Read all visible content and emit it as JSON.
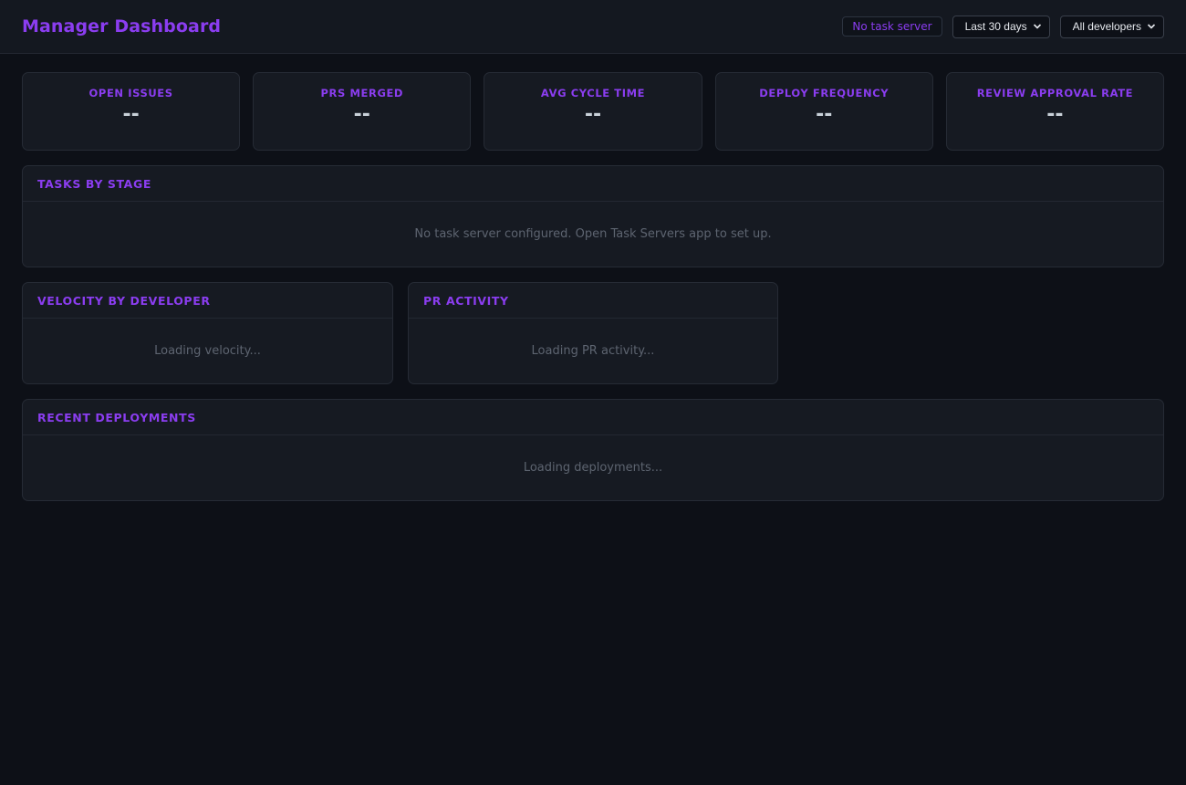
{
  "header": {
    "title": "Manager Dashboard",
    "status_badge": "No task server",
    "range_select": "Last 30 days",
    "developer_select": "All developers"
  },
  "stats": [
    {
      "label": "OPEN ISSUES",
      "value": "--"
    },
    {
      "label": "PRS MERGED",
      "value": "--"
    },
    {
      "label": "AVG CYCLE TIME",
      "value": "--"
    },
    {
      "label": "DEPLOY FREQUENCY",
      "value": "--"
    },
    {
      "label": "REVIEW APPROVAL RATE",
      "value": "--"
    }
  ],
  "panels": {
    "tasks_by_stage": {
      "title": "TASKS BY STAGE",
      "message": "No task server configured. Open Task Servers app to set up."
    },
    "velocity": {
      "title": "VELOCITY BY DEVELOPER",
      "message": "Loading velocity..."
    },
    "pr_activity": {
      "title": "PR ACTIVITY",
      "message": "Loading PR activity..."
    },
    "deployments": {
      "title": "RECENT DEPLOYMENTS",
      "message": "Loading deployments..."
    }
  },
  "icons": {
    "select_chevron": "chevron-down-icon"
  },
  "colors": {
    "accent": "#8b3df0",
    "background": "#0d1017",
    "surface": "#161a22",
    "muted_text": "#5d6470"
  }
}
